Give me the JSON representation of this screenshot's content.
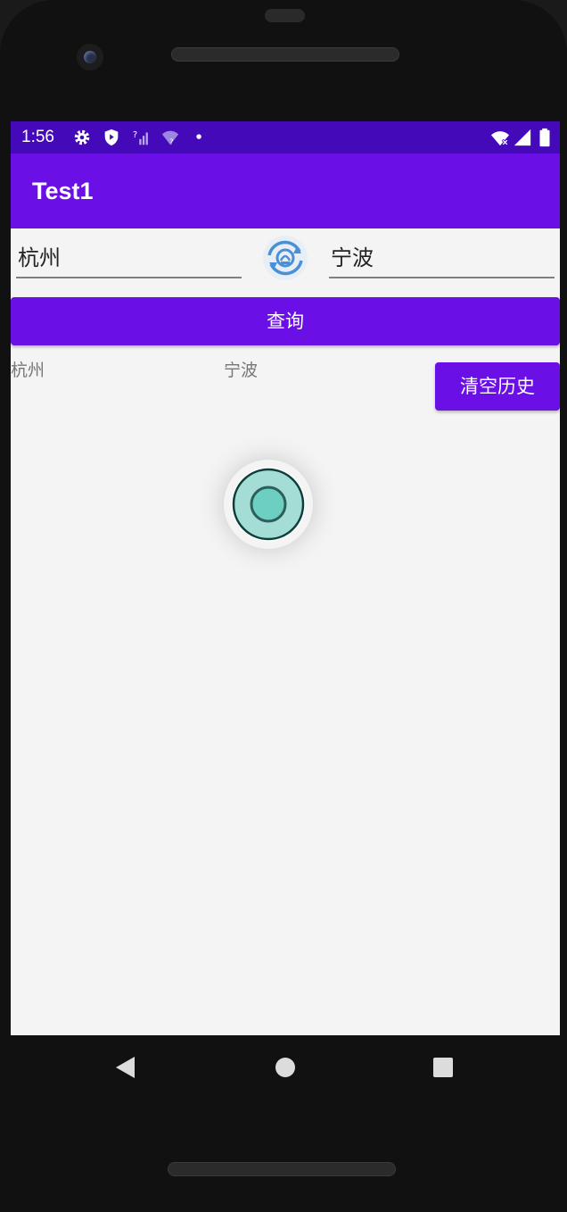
{
  "status_bar": {
    "time": "1:56",
    "icons": [
      "gear-icon",
      "shield-icon",
      "signal-question-icon",
      "wifi-question-icon",
      "dot-icon"
    ],
    "right_icons": [
      "wifi-off-icon",
      "cell-signal-icon",
      "battery-icon"
    ],
    "color": "#4409b8"
  },
  "app_bar": {
    "title": "Test1",
    "color": "#6a0fe6"
  },
  "form": {
    "from_value": "杭州",
    "to_value": "宁波",
    "swap_icon": "swap-cities-icon",
    "query_label": "查询"
  },
  "history": {
    "from": "杭州",
    "to": "宁波",
    "clear_label": "清空历史"
  },
  "nav_bar": {
    "icons": [
      "back-icon",
      "home-icon",
      "recents-icon"
    ]
  }
}
